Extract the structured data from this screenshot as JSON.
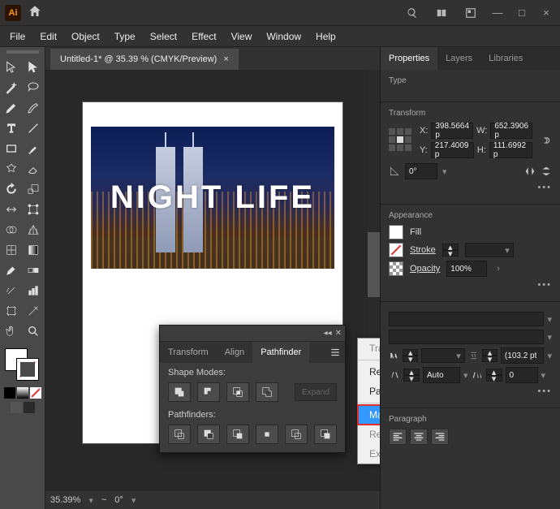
{
  "titlebar": {
    "app_short": "Ai"
  },
  "menu": {
    "items": [
      "File",
      "Edit",
      "Object",
      "Type",
      "Select",
      "Effect",
      "View",
      "Window",
      "Help"
    ]
  },
  "doc": {
    "tab_label": "Untitled-1* @ 35.39 % (CMYK/Preview)",
    "overlay_text": "NIGHT LIFE",
    "zoom": "35.39%",
    "nav_sep": "~",
    "nav_value": "0°"
  },
  "pathfinder": {
    "tabs": [
      "Transform",
      "Align",
      "Pathfinder"
    ],
    "shape_modes_label": "Shape Modes:",
    "pathfinders_label": "Pathfinders:",
    "expand": "Expand"
  },
  "ctx": {
    "items": [
      {
        "label": "Trap...",
        "disabled": true
      },
      {
        "label": "Repeat Add",
        "disabled": false
      },
      {
        "label": "Pathfinder Options...",
        "disabled": false
      },
      {
        "label": "Make Compound Shape",
        "disabled": false,
        "highlight": true
      },
      {
        "label": "Release Compound Shape",
        "disabled": true
      },
      {
        "label": "Expand Compound Shape",
        "disabled": true
      }
    ]
  },
  "rp": {
    "tabs": [
      "Properties",
      "Layers",
      "Libraries"
    ],
    "type_label": "Type",
    "transform_label": "Transform",
    "x_label": "X:",
    "y_label": "Y:",
    "w_label": "W:",
    "h_label": "H:",
    "x": "398.5664 p",
    "y": "217.4009 p",
    "w": "652.3906 p",
    "h": "111.6992 p",
    "rot": "0°",
    "appearance_label": "Appearance",
    "fill_label": "Fill",
    "stroke_label": "Stroke",
    "opacity_label": "Opacity",
    "opacity": "100%",
    "char_leading": "(103.2 pt",
    "char_kerning": "Auto",
    "char_tracking": "0",
    "paragraph_label": "Paragraph"
  }
}
